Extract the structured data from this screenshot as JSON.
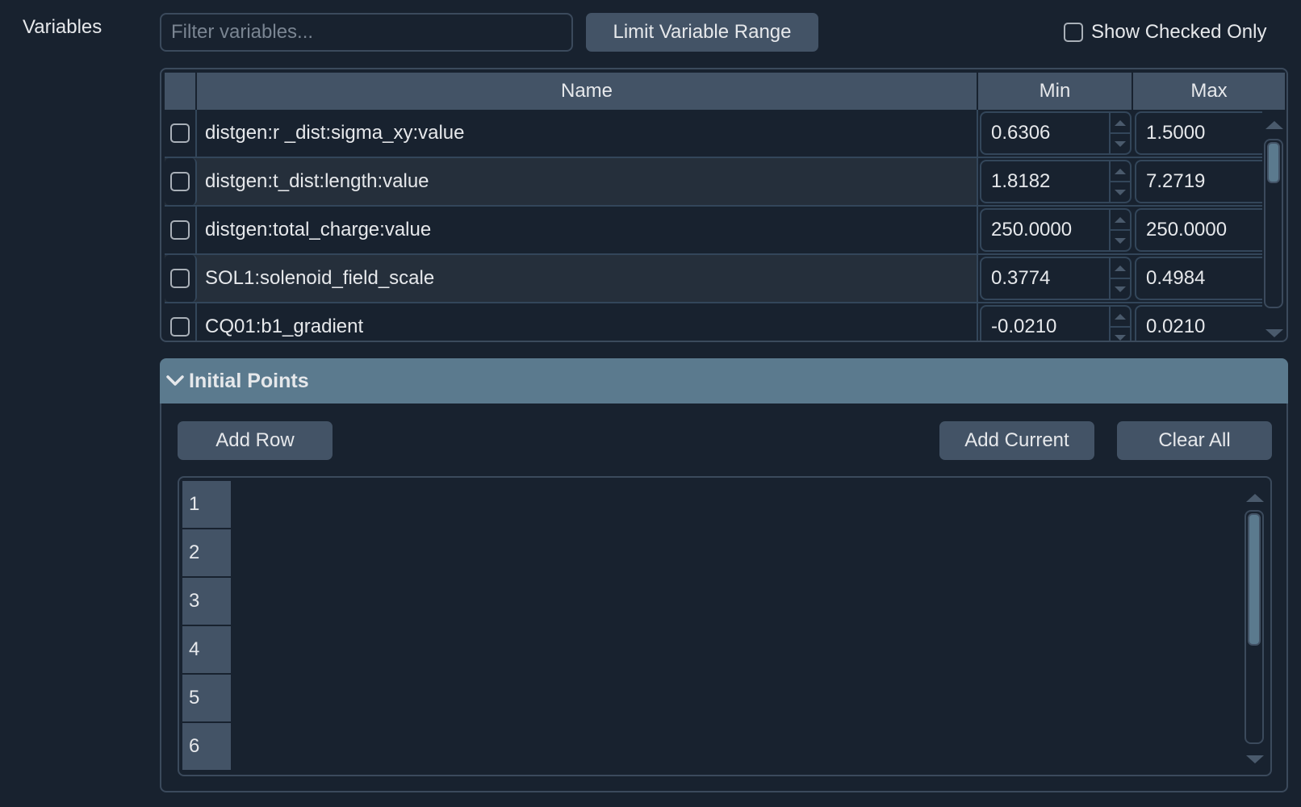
{
  "variables": {
    "label": "Variables",
    "filter_placeholder": "Filter variables...",
    "filter_value": "",
    "limit_button": "Limit Variable Range",
    "show_checked_only": {
      "label": "Show Checked Only",
      "checked": false
    },
    "table": {
      "columns": {
        "check": "",
        "name": "Name",
        "min": "Min",
        "max": "Max"
      },
      "rows": [
        {
          "name": "distgen:r _dist:sigma_xy:value",
          "min": "0.6306",
          "max": "1.5000",
          "checked": false
        },
        {
          "name": "distgen:t_dist:length:value",
          "min": "1.8182",
          "max": "7.2719",
          "checked": false
        },
        {
          "name": "distgen:total_charge:value",
          "min": "250.0000",
          "max": "250.0000",
          "checked": false
        },
        {
          "name": "SOL1:solenoid_field_scale",
          "min": "0.3774",
          "max": "0.4984",
          "checked": false
        },
        {
          "name": "CQ01:b1_gradient",
          "min": "-0.0210",
          "max": "0.0210",
          "checked": false
        }
      ],
      "scroll_position": 0.0,
      "scroll_visible_fraction": 0.25
    }
  },
  "initial_points": {
    "title": "Initial Points",
    "expanded": true,
    "add_row_button": "Add Row",
    "add_current_button": "Add Current",
    "clear_all_button": "Clear All",
    "row_headers": [
      "1",
      "2",
      "3",
      "4",
      "5",
      "6"
    ],
    "scroll_position": 0.0,
    "scroll_visible_fraction": 0.58
  },
  "colors": {
    "background": "#18222f",
    "button": "#435366",
    "accent": "#5b7a8e",
    "border": "#3b4a5c",
    "text": "#e6e8eb"
  }
}
